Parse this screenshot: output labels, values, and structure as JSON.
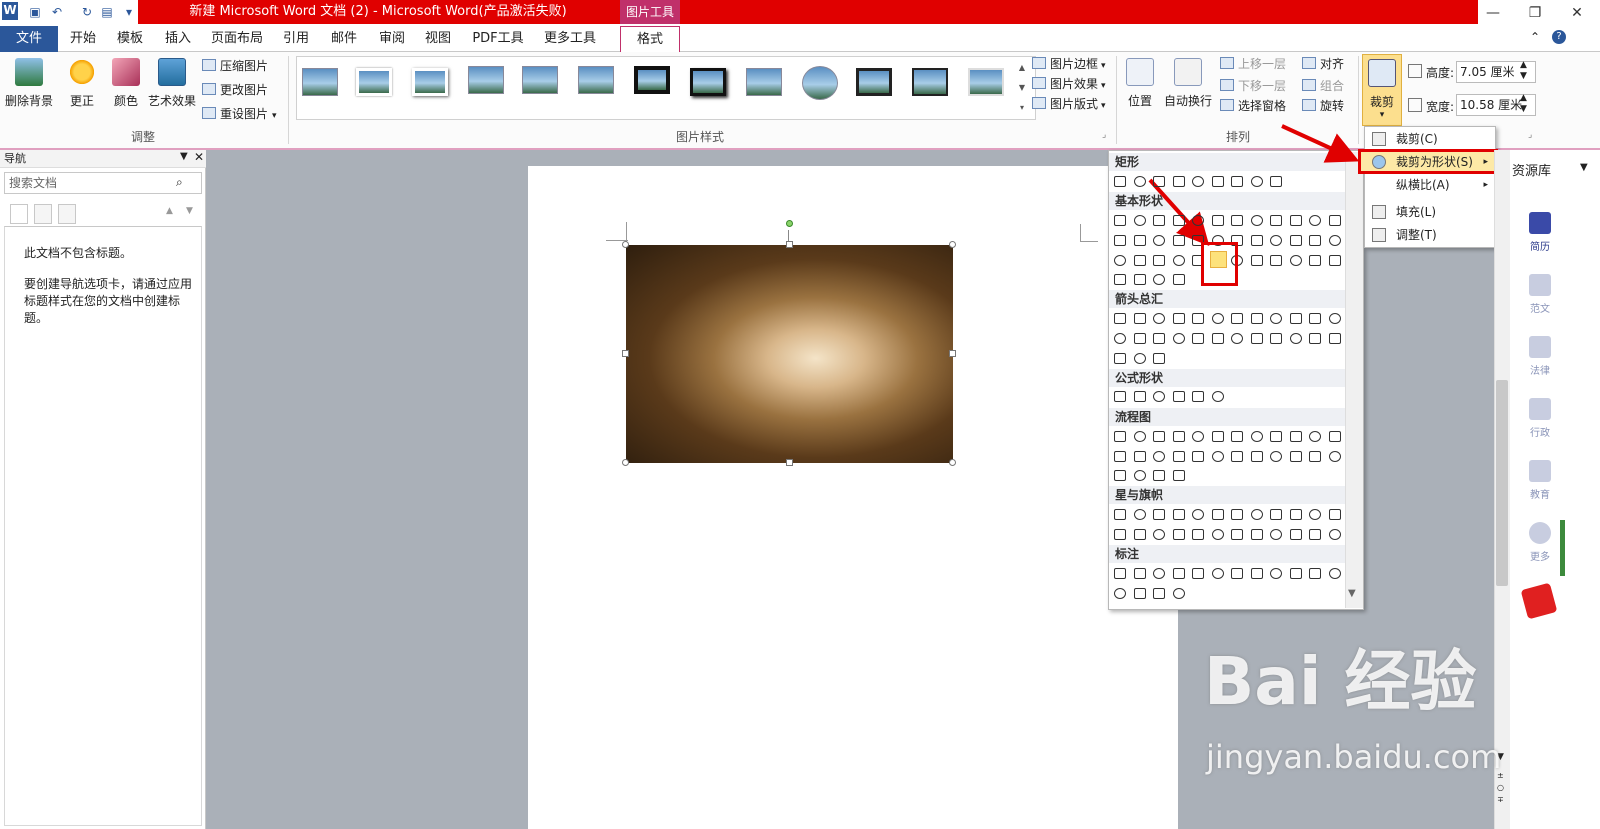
{
  "window": {
    "title": "新建 Microsoft Word 文档 (2) - Microsoft Word(产品激活失败)",
    "contextual_tab": "图片工具",
    "controls": {
      "minimize": "—",
      "restore": "❐",
      "close": "✕"
    }
  },
  "tabs": [
    "文件",
    "开始",
    "模板",
    "插入",
    "页面布局",
    "引用",
    "邮件",
    "审阅",
    "视图",
    "PDF工具",
    "更多工具",
    "格式"
  ],
  "ribbon": {
    "adjust": {
      "remove_bg": "删除背景",
      "corrections": "更正",
      "color": "颜色",
      "artistic": "艺术效果",
      "compress": "压缩图片",
      "change": "更改图片",
      "reset": "重设图片",
      "group_label": "调整"
    },
    "styles": {
      "border": "图片边框",
      "effects": "图片效果",
      "layout": "图片版式",
      "group_label": "图片样式"
    },
    "arrange": {
      "position": "位置",
      "wrap": "自动换行",
      "bring_forward": "上移一层",
      "send_backward": "下移一层",
      "selection_pane": "选择窗格",
      "align": "对齐",
      "group": "组合",
      "rotate": "旋转",
      "group_label": "排列"
    },
    "size": {
      "crop": "裁剪",
      "height_label": "高度:",
      "height_value": "7.05 厘米",
      "width_label": "宽度:",
      "width_value": "10.58 厘米"
    }
  },
  "nav": {
    "title": "导航",
    "search_placeholder": "搜索文档",
    "msg1": "此文档不包含标题。",
    "msg2": "要创建导航选项卡，请通过应用标题样式在您的文档中创建标题。"
  },
  "shape_panel": {
    "sections": [
      "矩形",
      "基本形状",
      "箭头总汇",
      "公式形状",
      "流程图",
      "星与旗帜",
      "标注"
    ]
  },
  "crop_menu": {
    "items": [
      "裁剪(C)",
      "裁剪为形状(S)",
      "纵横比(A)",
      "填充(L)",
      "调整(T)"
    ]
  },
  "right_sidebar": {
    "title": "资源库",
    "items": [
      "简历",
      "范文",
      "法律",
      "行政",
      "教育",
      "更多"
    ]
  },
  "watermark": {
    "brand": "Bai 经验",
    "url": "jingyan.baidu.com"
  }
}
